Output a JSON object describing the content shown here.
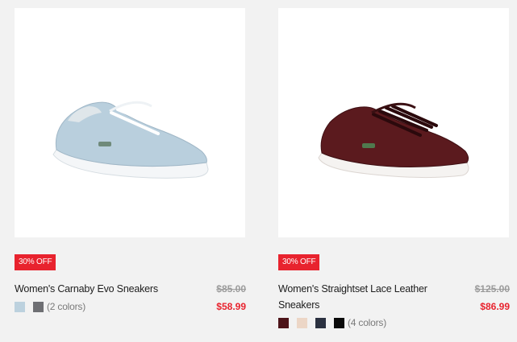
{
  "products": [
    {
      "badge": "30% OFF",
      "title": "Women's Carnaby Evo Sneakers",
      "price_old": "$85.00",
      "price_new": "$58.99",
      "color_count": "(2 colors)",
      "swatches": [
        "#bcd1de",
        "#6e6f73"
      ],
      "shoe_color": "#b9cfdd"
    },
    {
      "badge": "30% OFF",
      "title": "Women's Straightset Lace Leather Sneakers",
      "price_old": "$125.00",
      "price_new": "$86.99",
      "color_count": "(4 colors)",
      "swatches": [
        "#4d1419",
        "#ecd6c6",
        "#2b3140",
        "#0a0a0a"
      ],
      "shoe_color": "#5b1a1e"
    }
  ],
  "colors": {
    "sale_red": "#e8232e",
    "page_bg": "#f2f2f2"
  }
}
